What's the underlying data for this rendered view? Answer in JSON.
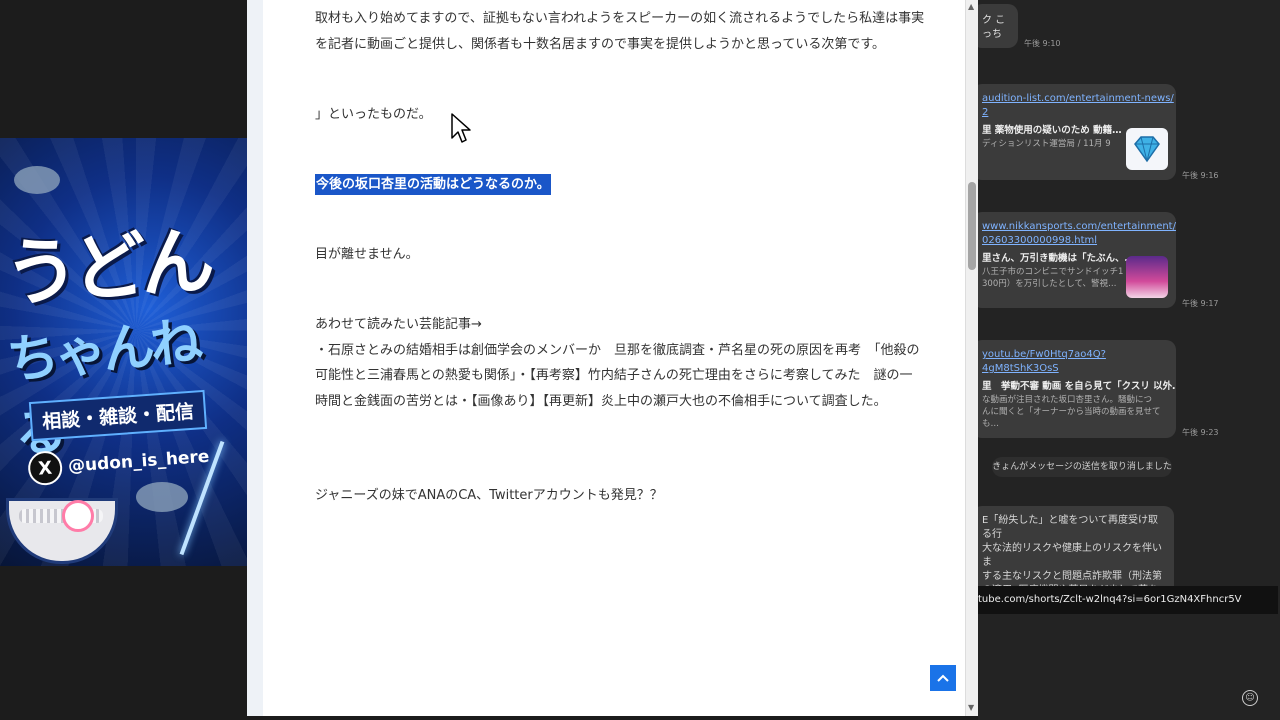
{
  "banner": {
    "title_line1": "うどん",
    "title_line2": "ちゃんねる",
    "tags": "相談・雑談・配信",
    "handle": "@udon_is_here",
    "x_icon": "x-logo-icon"
  },
  "article": {
    "p1": "取材も入り始めてますので、証拠もない言われようをスピーカーの如く流されるようでしたら私達は事実を記者に動画ごと提供し、関係者も十数名居ますので事実を提供しようかと思っている次第です。",
    "p2": "」といったものだ。",
    "p3": "今後の坂口杏里の活動はどうなるのか。",
    "p4": "目が離せません。",
    "p5": "あわせて読みたい芸能記事→\n・石原さとみの結婚相手は創価学会のメンバーか　旦那を徹底調査・芦名星の死の原因を再考　「他殺の可能性と三浦春馬との熱愛も関係」・【再考察】竹内結子さんの死亡理由をさらに考察してみた　謎の一時間と金銭面の苦労とは・【画像あり】【再更新】炎上中の瀬戸大也の不倫相手について調査した。",
    "p6": "ジャニーズの妹でANAのCA、Twitterアカウントも発見？？",
    "scroll_top_icon": "chevron-up-icon"
  },
  "chat": {
    "b1_text": "ク こっち",
    "t1": "午後 9:10",
    "b2_link1": "audition-list.com/entertainment-news/",
    "b2_link2": "2",
    "b2_title": "里 薬物使用の疑いのため 動籍…",
    "b2_desc": "ディションリスト運営局 / 11月 9",
    "t2": "午後 9:16",
    "b3_link1": "www.nikkansports.com/entertainment/",
    "b3_link2": "02603300000998.html",
    "b3_title": "里さん、万引き動機は「たぶん、…",
    "b3_desc": "八王子市のコンビニでサンドイッチ1\n300円）を万引したとして、警視…",
    "t3": "午後 9:17",
    "b4_link1": "youtu.be/Fw0Htq7ao4Q?",
    "b4_link2": "4gM8tShK3OsS",
    "b4_title": "里　挙動不審 動画 を自ら見て「クスリ 以外…",
    "b4_desc": "な動画が注目された坂口杏里さん。騒動につ\nんに聞くと「オーナーから当時の動画を見せても…",
    "t4": "午後 9:23",
    "sysmsg": "きょんがメッセージの送信を取り消しました",
    "b5_text": "E「紛失した」と嘘をついて再度受け取る行\n大な法的リスクや健康上のリスクを伴いま\nする主なリスクと問題点詐欺罪（刑法第\nの適用: 医療機関や薬局をだまして薬を交\n行為は、詐欺罪に問われる可能性がありま",
    "tooltip": "tube.com/shorts/Zclt-w2lnq4?si=6or1GzN4XFhncr5V",
    "emoji_icon": "smiley-icon"
  }
}
